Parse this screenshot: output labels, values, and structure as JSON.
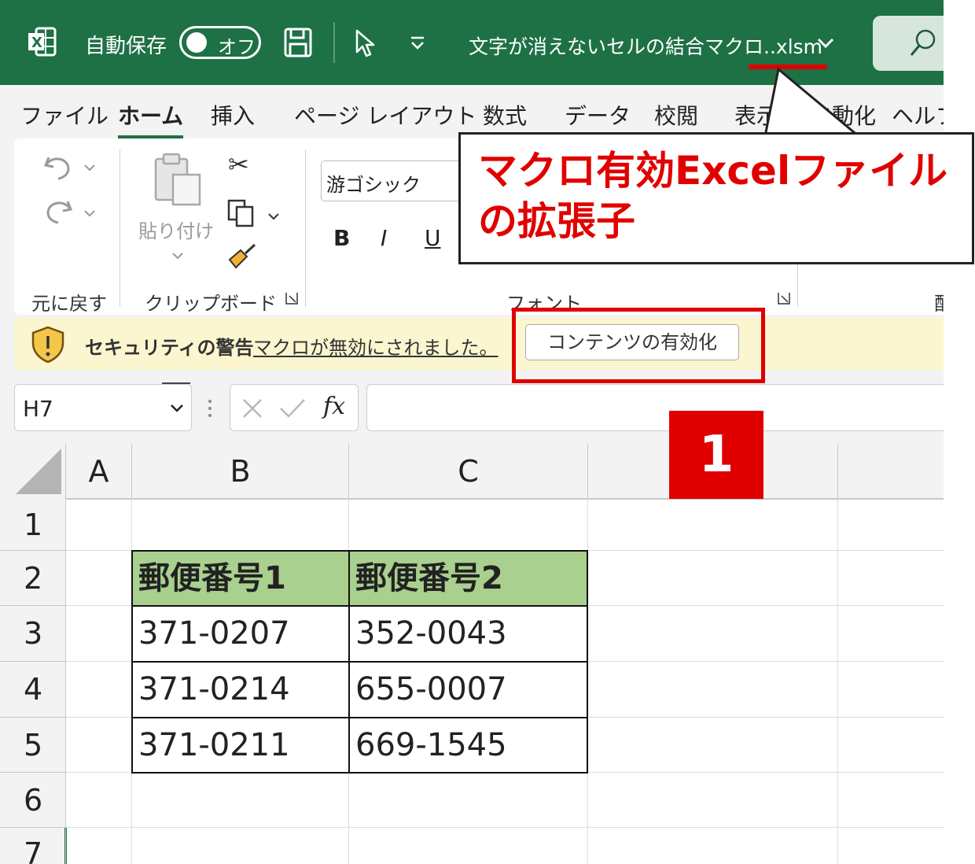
{
  "titlebar": {
    "autosave_label": "自動保存",
    "autosave_state": "オフ",
    "filename": "文字が消えないセルの結合マクロ..xlsm"
  },
  "tabs": [
    "ファイル",
    "ホーム",
    "挿入",
    "ページ レイアウト",
    "数式",
    "データ",
    "校閲",
    "表示",
    "自動化",
    "ヘルプ"
  ],
  "active_tab": "ホーム",
  "ribbon": {
    "undo_group_label": "元に戻す",
    "paste_label": "貼り付け",
    "clipboard_group_label": "クリップボード",
    "font_name": "游ゴシック",
    "font_group_label": "フォント",
    "bold": "B",
    "italic": "I",
    "underline": "U",
    "cut_glyph": "✂",
    "right_edge_glyph": "配"
  },
  "security_bar": {
    "title": "セキュリティの警告",
    "message": "マクロが無効にされました。",
    "button_label": "コンテンツの有効化"
  },
  "formula_bar": {
    "name_box": "H7",
    "fx_label": "fx",
    "formula": ""
  },
  "grid": {
    "columns": [
      "A",
      "B",
      "C"
    ],
    "rows": [
      "1",
      "2",
      "3",
      "4",
      "5",
      "6",
      "7"
    ],
    "table_header": [
      "郵便番号1",
      "郵便番号2"
    ],
    "table_rows": [
      [
        "371-0207",
        "352-0043"
      ],
      [
        "371-0214",
        "655-0007"
      ],
      [
        "371-0211",
        "669-1545"
      ]
    ]
  },
  "annotations": {
    "callout_text": "マクロ有効Excelファイルの拡張子",
    "step_badge": "1",
    "highlight_color": "#e00000"
  },
  "colors": {
    "title_bar": "#1e7145",
    "header_fill": "#a9d08e",
    "security_bar": "#fbf6cf"
  }
}
